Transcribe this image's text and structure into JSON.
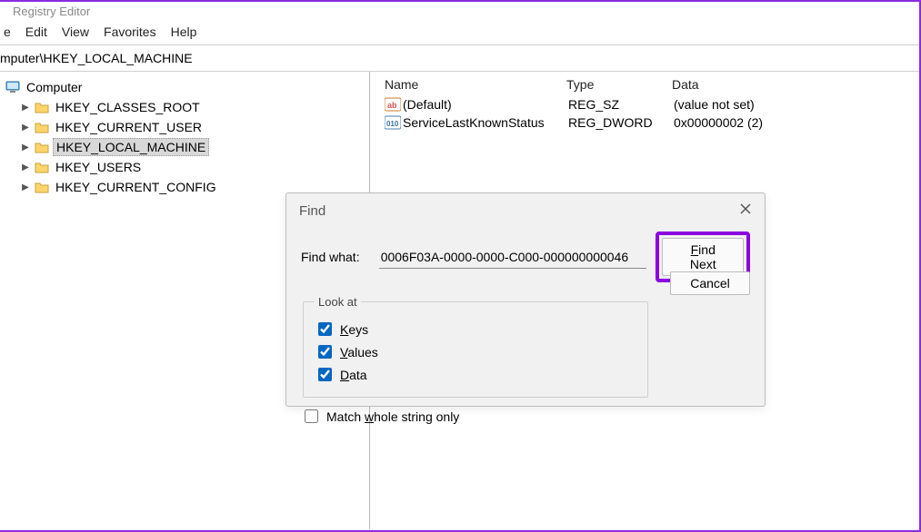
{
  "window": {
    "title": "Registry Editor"
  },
  "menu": {
    "items": [
      "e",
      "Edit",
      "View",
      "Favorites",
      "Help"
    ]
  },
  "address": "mputer\\HKEY_LOCAL_MACHINE",
  "tree": {
    "root": "Computer",
    "items": [
      {
        "label": "HKEY_CLASSES_ROOT",
        "selected": false
      },
      {
        "label": "HKEY_CURRENT_USER",
        "selected": false
      },
      {
        "label": "HKEY_LOCAL_MACHINE",
        "selected": true
      },
      {
        "label": "HKEY_USERS",
        "selected": false
      },
      {
        "label": "HKEY_CURRENT_CONFIG",
        "selected": false
      }
    ]
  },
  "list": {
    "headers": {
      "name": "Name",
      "type": "Type",
      "data": "Data"
    },
    "rows": [
      {
        "name": "(Default)",
        "type": "REG_SZ",
        "data": "(value not set)"
      },
      {
        "name": "ServiceLastKnownStatus",
        "type": "REG_DWORD",
        "data": "0x00000002 (2)"
      }
    ]
  },
  "dialog": {
    "title": "Find",
    "find_what_label": "Find what:",
    "find_what_value": "0006F03A-0000-0000-C000-000000000046",
    "find_next": "Find Next",
    "cancel": "Cancel",
    "look_at_legend": "Look at",
    "keys": "Keys",
    "values": "Values",
    "data": "Data",
    "match_whole": "Match whole string only"
  }
}
